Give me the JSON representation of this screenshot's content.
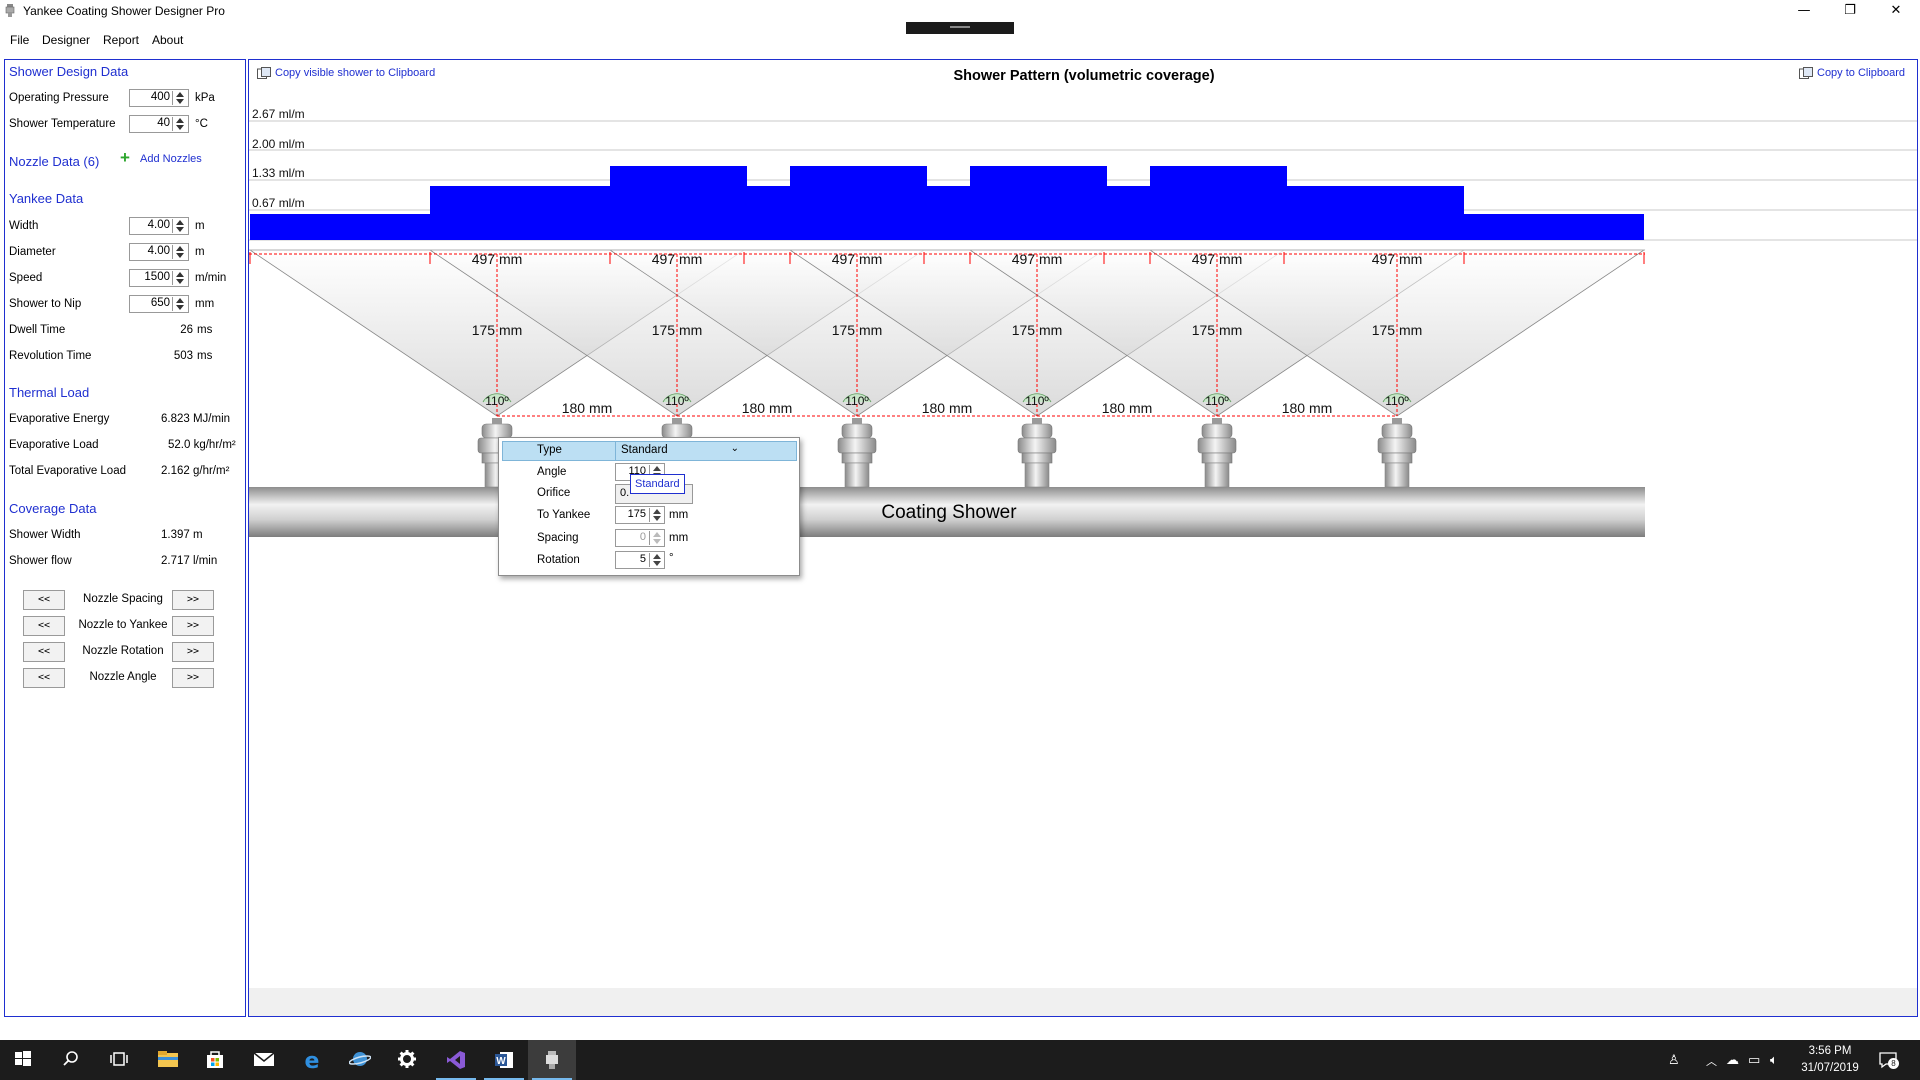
{
  "window": {
    "title": "Yankee Coating Shower Designer Pro",
    "minimize_glyph": "—",
    "restore_glyph": "❐",
    "close_glyph": "✕"
  },
  "menu": [
    "File",
    "Designer",
    "Report",
    "About"
  ],
  "left": {
    "shower_design": {
      "title": "Shower Design Data",
      "operating_pressure": {
        "label": "Operating Pressure",
        "value": "400",
        "unit": "kPa"
      },
      "shower_temperature": {
        "label": "Shower Temperature",
        "value": "40",
        "unit": "°C"
      }
    },
    "nozzle_data": {
      "title": "Nozzle Data (6)",
      "add_label": "Add Nozzles"
    },
    "yankee": {
      "title": "Yankee Data",
      "width": {
        "label": "Width",
        "value": "4.00",
        "unit": "m"
      },
      "diameter": {
        "label": "Diameter",
        "value": "4.00",
        "unit": "m"
      },
      "speed": {
        "label": "Speed",
        "value": "1500",
        "unit": "m/min"
      },
      "shower_to_nip": {
        "label": "Shower to Nip",
        "value": "650",
        "unit": "mm"
      },
      "dwell_time": {
        "label": "Dwell Time",
        "value": "26",
        "unit": "ms"
      },
      "revolution_time": {
        "label": "Revolution Time",
        "value": "503",
        "unit": "ms"
      }
    },
    "thermal": {
      "title": "Thermal Load",
      "evap_energy": {
        "label": "Evaporative Energy",
        "value": "6.823 MJ/min"
      },
      "evap_load": {
        "label": "Evaporative Load",
        "value": "52.0 kg/hr/m²"
      },
      "total_evap": {
        "label": "Total Evaporative Load",
        "value": "2.162 g/hr/m²"
      }
    },
    "coverage": {
      "title": "Coverage Data",
      "shower_width": {
        "label": "Shower Width",
        "value": "1.397 m"
      },
      "shower_flow": {
        "label": "Shower flow",
        "value": "2.717 l/min"
      }
    },
    "adjust": {
      "prev": "<<",
      "next": ">>",
      "rows": [
        "Nozzle Spacing",
        "Nozzle to Yankee",
        "Nozzle Rotation",
        "Nozzle Angle"
      ]
    }
  },
  "main": {
    "copy_visible": "Copy visible shower to Clipboard",
    "copy_clip": "Copy to Clipboard",
    "title": "Shower Pattern (volumetric coverage)",
    "y_levels": [
      "2.67 ml/m",
      "2.00 ml/m",
      "1.33 ml/m",
      "0.67 ml/m"
    ],
    "coverage_levels": [
      1,
      2,
      3
    ],
    "nozzle_spacing_label": "497 mm",
    "to_yankee_label": "175 mm",
    "gap_label": "180 mm",
    "angle_label": "110º",
    "nozzle_count": 6,
    "header_label": "Coating Shower",
    "colors": {
      "coverage": "#0000ff",
      "guide": "#ff0000",
      "accent": "#1f2fd0"
    }
  },
  "popup": {
    "type": {
      "label": "Type",
      "value": "Standard"
    },
    "angle": {
      "label": "Angle",
      "value": "110"
    },
    "orifice": {
      "label": "Orifice",
      "value": "0."
    },
    "to_yankee": {
      "label": "To Yankee",
      "value": "175",
      "unit": "mm"
    },
    "spacing": {
      "label": "Spacing",
      "value": "0",
      "unit": "mm"
    },
    "rotation": {
      "label": "Rotation",
      "value": "5",
      "unit": "°"
    },
    "tooltip": "Standard"
  },
  "taskbar": {
    "time": "3:56 PM",
    "date": "31/07/2019",
    "notif_count": "8"
  }
}
